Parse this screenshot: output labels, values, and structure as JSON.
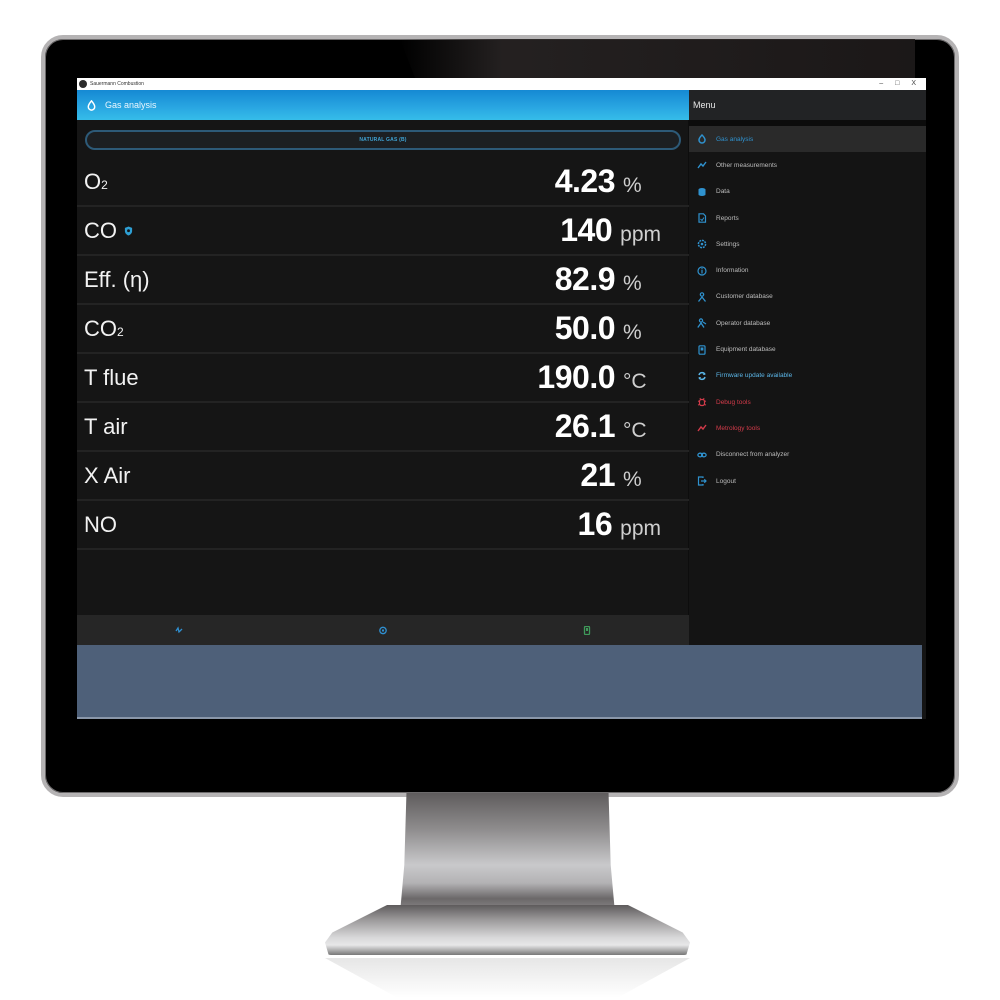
{
  "window": {
    "title": "Sauermann Combustion",
    "controls": [
      "–",
      "□",
      "X"
    ]
  },
  "header": {
    "title": "Gas analysis",
    "icon": "drop-icon"
  },
  "menu": {
    "title": "Menu",
    "items": [
      {
        "label": "Gas analysis",
        "icon": "drop-icon",
        "state": "active"
      },
      {
        "label": "Other measurements",
        "icon": "trend-line-icon",
        "state": "normal"
      },
      {
        "label": "Data",
        "icon": "database-icon",
        "state": "normal"
      },
      {
        "label": "Reports",
        "icon": "document-icon",
        "state": "normal"
      },
      {
        "label": "Settings",
        "icon": "gear-icon",
        "state": "normal"
      },
      {
        "label": "Information",
        "icon": "info-icon",
        "state": "normal"
      },
      {
        "label": "Customer database",
        "icon": "person-icon",
        "state": "normal"
      },
      {
        "label": "Operator database",
        "icon": "operator-icon",
        "state": "normal"
      },
      {
        "label": "Equipment database",
        "icon": "device-icon",
        "state": "normal"
      },
      {
        "label": "Firmware update available",
        "icon": "sync-icon",
        "state": "update"
      },
      {
        "label": "Debug tools",
        "icon": "bug-icon",
        "state": "danger"
      },
      {
        "label": "Metrology tools",
        "icon": "trend-line-icon",
        "state": "danger"
      },
      {
        "label": "Disconnect from analyzer",
        "icon": "link-icon",
        "state": "normal"
      },
      {
        "label": "Logout",
        "icon": "logout-icon",
        "state": "normal"
      }
    ]
  },
  "main": {
    "fuel": "NATURAL GAS (B)",
    "measurements": [
      {
        "label": "O",
        "sub": "2",
        "value": "4.23",
        "unit": "%"
      },
      {
        "label": "CO",
        "sub": "",
        "value": "140",
        "unit": "ppm",
        "badge": "shield-icon"
      },
      {
        "label": "Eff. (η)",
        "sub": "",
        "value": "82.9",
        "unit": "%"
      },
      {
        "label": "CO",
        "sub": "2",
        "value": "50.0",
        "unit": "%"
      },
      {
        "label": "T flue",
        "sub": "",
        "value": "190.0",
        "unit": "°C"
      },
      {
        "label": "T air",
        "sub": "",
        "value": "26.1",
        "unit": "°C"
      },
      {
        "label": "X Air",
        "sub": "",
        "value": "21",
        "unit": "%"
      },
      {
        "label": "NO",
        "sub": "",
        "value": "16",
        "unit": "ppm"
      }
    ]
  },
  "bottom_bar": {
    "tabs": [
      {
        "icon": "pulse-icon",
        "color": "#2f8fd0"
      },
      {
        "icon": "save-icon",
        "color": "#2f8fd0"
      },
      {
        "icon": "phone-icon",
        "color": "#3f9a5a"
      }
    ]
  },
  "colors": {
    "accent": "#2aa7e2",
    "danger": "#d33b4a",
    "update": "#5bb6e8",
    "taskbar": "#4e6079"
  }
}
